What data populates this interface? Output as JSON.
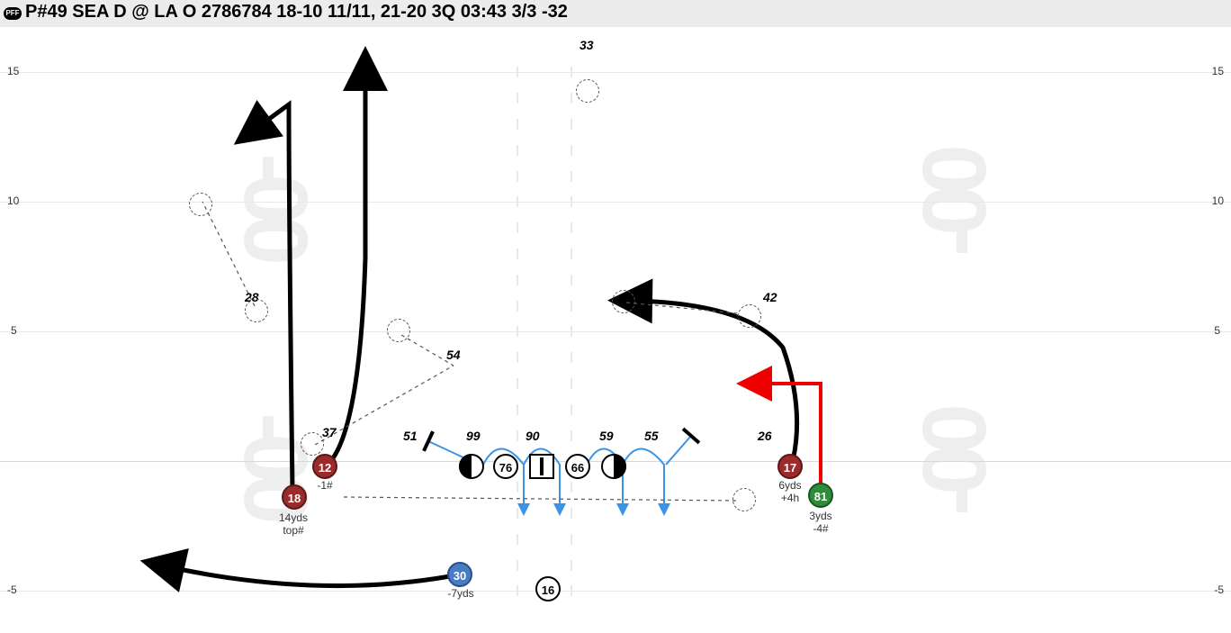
{
  "title": "P#49 SEA D @ LA O 2786784 18-10 11/11, 21-20 3Q 03:43 3/3 -32",
  "logo_text": "PFF",
  "yard_markers": {
    "left_15": "15",
    "right_15": "15",
    "left_10": "10",
    "right_10": "10",
    "left_5": "5",
    "right_5": "5",
    "left_m5": "-5",
    "right_m5": "-5"
  },
  "big_numbers": {
    "goal": "-00"
  },
  "offense": {
    "p18": {
      "num": "18",
      "sub1": "14yds",
      "sub2": "top#"
    },
    "p12": {
      "num": "12",
      "sub1": "-1#"
    },
    "p76": {
      "num": "76"
    },
    "p66": {
      "num": "66"
    },
    "p17": {
      "num": "17",
      "sub1": "6yds",
      "sub2": "+4h"
    },
    "p81": {
      "num": "81",
      "sub1": "3yds",
      "sub2": "-4#"
    },
    "p30": {
      "num": "30",
      "sub1": "-7yds"
    },
    "p16": {
      "num": "16"
    }
  },
  "defense": {
    "d33": "33",
    "d28": "28",
    "d37": "37",
    "d54": "54",
    "d42": "42",
    "d26": "26",
    "d51": "51",
    "d99": "99",
    "d90": "90",
    "d59": "59",
    "d55": "55"
  }
}
